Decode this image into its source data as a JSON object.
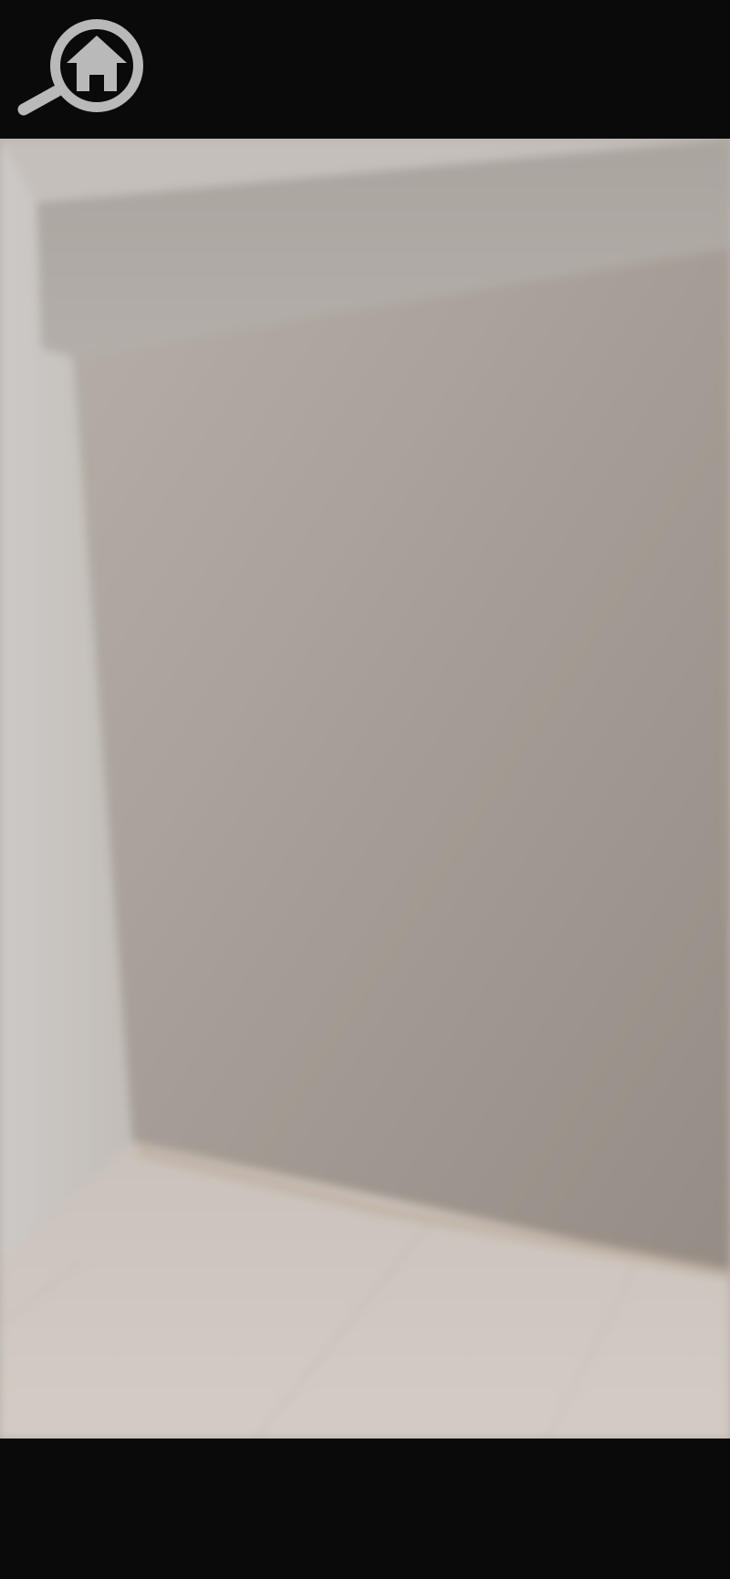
{
  "app": {
    "logo_icon": "house-magnifier-icon",
    "logo_color": "#b9b9b9",
    "bar_color": "#0a0a0a"
  },
  "viewer": {
    "image_subject": "room-interior-photo",
    "wall_color": "#a49c94",
    "side_wall_color": "#c8c4c0",
    "floor_color": "#d0c9c2"
  }
}
